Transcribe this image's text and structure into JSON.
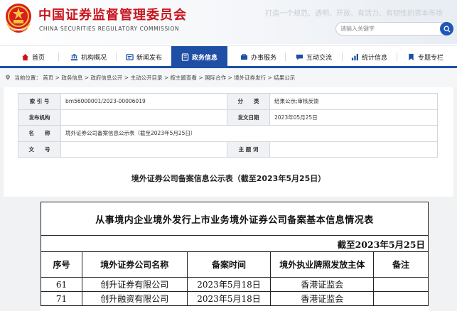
{
  "header": {
    "title": "中国证券监督管理委员会",
    "subtitle": "CHINA SECURITIES REGULATORY COMMISSION",
    "slogan": "打造一个规范、透明、开放、有活力、有韧性的资本市场",
    "search_placeholder": "请输入关键字"
  },
  "nav": {
    "items": [
      {
        "label": "首页",
        "icon": "home-icon"
      },
      {
        "label": "机构概况",
        "icon": "building-icon"
      },
      {
        "label": "新闻发布",
        "icon": "news-icon"
      },
      {
        "label": "政务信息",
        "icon": "info-icon",
        "active": true
      },
      {
        "label": "办事服务",
        "icon": "service-icon"
      },
      {
        "label": "互动交流",
        "icon": "chat-icon"
      },
      {
        "label": "统计信息",
        "icon": "stats-icon"
      },
      {
        "label": "专题专栏",
        "icon": "bookmark-icon"
      }
    ],
    "accent": "#1e4fa4"
  },
  "breadcrumb": {
    "prefix": "当前位置：",
    "items": [
      "首页",
      "政务信息",
      "政府信息公开",
      "主动公开目录",
      "按主题查看",
      "国际合作",
      "境外证券发行",
      "结果公示"
    ],
    "separator": " > "
  },
  "meta": {
    "index_label": "索 引 号",
    "index_value": "bm56000001/2023-00006019",
    "category_label": "分　　类",
    "category_value": "结果公示;审核反馈",
    "publisher_label": "发布机构",
    "publisher_value": "",
    "date_label": "发文日期",
    "date_value": "2023年05月25日",
    "name_label": "名　　称",
    "name_value": "境外证券公司备案信息公示表（截至2023年5月25日）",
    "docno_label": "文　　号",
    "docno_value": "",
    "subject_label": "主 题 词",
    "subject_value": ""
  },
  "document": {
    "heading": "境外证券公司备案信息公示表（截至2023年5月25日）",
    "table_caption": "从事境内企业境外发行上市业务境外证券公司备案基本信息情况表",
    "as_of": "截至2023年5月25日",
    "columns": [
      "序号",
      "境外证券公司名称",
      "备案时间",
      "境外执业牌照发放主体",
      "备注"
    ],
    "rows": [
      [
        "61",
        "创升证券有限公司",
        "2023年5月18日",
        "香港证监会",
        ""
      ],
      [
        "71",
        "创升融资有限公司",
        "2023年5月18日",
        "香港证监会",
        ""
      ]
    ]
  },
  "colors": {
    "brand_red": "#c9141d",
    "nav_blue": "#1e4fa4",
    "search_blue": "#2057b5"
  }
}
